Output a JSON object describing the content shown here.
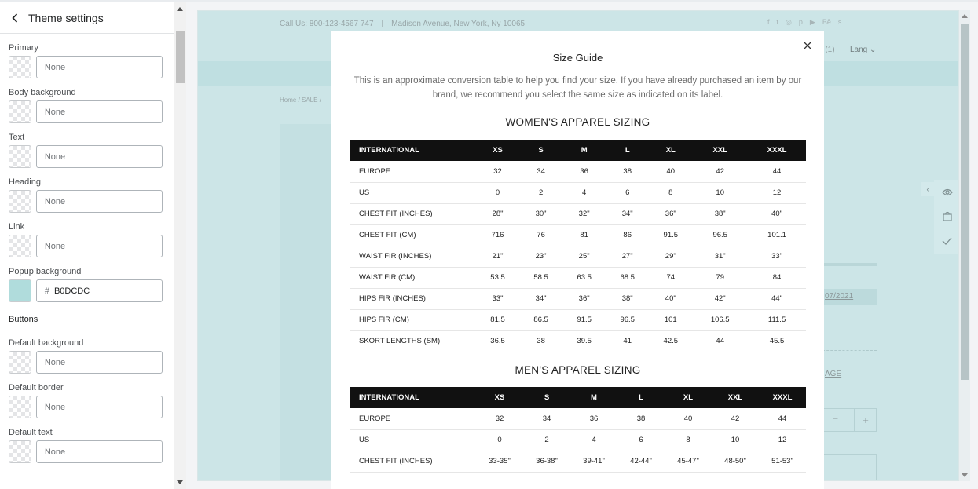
{
  "sidebar": {
    "title": "Theme settings",
    "fields": [
      {
        "label": "Primary",
        "value": "None"
      },
      {
        "label": "Body background",
        "value": "None"
      },
      {
        "label": "Text",
        "value": "None"
      },
      {
        "label": "Heading",
        "value": "None"
      },
      {
        "label": "Link",
        "value": "None"
      },
      {
        "label": "Popup background",
        "hash": "#",
        "value": "B0DCDC"
      }
    ],
    "buttons_heading": "Buttons",
    "button_fields": [
      {
        "label": "Default background",
        "value": "None"
      },
      {
        "label": "Default border",
        "value": "None"
      },
      {
        "label": "Default text",
        "value": "None"
      }
    ]
  },
  "colors": {
    "popup_background": "#B0DCDC",
    "preview_background": "#cce5e7",
    "table_header": "#111111"
  },
  "site": {
    "contact_phone": "Call Us: 800-123-4567 747",
    "contact_sep": "|",
    "contact_address": "Madison Avenue, New York, Ny 10065",
    "social": [
      "f",
      "t",
      "◎",
      "p",
      "▶",
      "Bē",
      "s"
    ],
    "cart_partial": "g (1)",
    "lang": "Lang",
    "breadcrumb": "Home  /  SALE  /",
    "date_partial": "07/2021",
    "link_partial": "AGE",
    "qty_minus": "−",
    "qty_plus": "+"
  },
  "modal": {
    "title": "Size Guide",
    "description": "This is an approximate conversion table to help you find your size. If you have already purchased an item by our brand, we recommend you select the same size as indicated on its label.",
    "close_label": "×",
    "womens": {
      "title": "WOMEN'S APPAREL SIZING",
      "headers": [
        "INTERNATIONAL",
        "XS",
        "S",
        "M",
        "L",
        "XL",
        "XXL",
        "XXXL"
      ],
      "rows": [
        [
          "EUROPE",
          "32",
          "34",
          "36",
          "38",
          "40",
          "42",
          "44"
        ],
        [
          "US",
          "0",
          "2",
          "4",
          "6",
          "8",
          "10",
          "12"
        ],
        [
          "CHEST FIT (INCHES)",
          "28\"",
          "30\"",
          "32\"",
          "34\"",
          "36\"",
          "38\"",
          "40\""
        ],
        [
          "CHEST FIT (CM)",
          "716",
          "76",
          "81",
          "86",
          "91.5",
          "96.5",
          "101.1"
        ],
        [
          "WAIST FIR (INCHES)",
          "21\"",
          "23\"",
          "25\"",
          "27\"",
          "29\"",
          "31\"",
          "33\""
        ],
        [
          "WAIST FIR (CM)",
          "53.5",
          "58.5",
          "63.5",
          "68.5",
          "74",
          "79",
          "84"
        ],
        [
          "HIPS FIR (INCHES)",
          "33\"",
          "34\"",
          "36\"",
          "38\"",
          "40\"",
          "42\"",
          "44\""
        ],
        [
          "HIPS FIR (CM)",
          "81.5",
          "86.5",
          "91.5",
          "96.5",
          "101",
          "106.5",
          "111.5"
        ],
        [
          "SKORT LENGTHS (SM)",
          "36.5",
          "38",
          "39.5",
          "41",
          "42.5",
          "44",
          "45.5"
        ]
      ]
    },
    "mens": {
      "title": "MEN'S APPAREL SIZING",
      "headers": [
        "INTERNATIONAL",
        "XS",
        "S",
        "M",
        "L",
        "XL",
        "XXL",
        "XXXL"
      ],
      "rows": [
        [
          "EUROPE",
          "32",
          "34",
          "36",
          "38",
          "40",
          "42",
          "44"
        ],
        [
          "US",
          "0",
          "2",
          "4",
          "6",
          "8",
          "10",
          "12"
        ],
        [
          "CHEST FIT (INCHES)",
          "33-35\"",
          "36-38\"",
          "39-41\"",
          "42-44\"",
          "45-47\"",
          "48-50\"",
          "51-53\""
        ]
      ]
    }
  },
  "icons": {
    "back": "chevron-left-icon",
    "close": "close-icon",
    "view": "eye-icon",
    "cart": "shopping-bag-icon",
    "check": "check-icon",
    "toggle": "chevron-left-icon"
  }
}
